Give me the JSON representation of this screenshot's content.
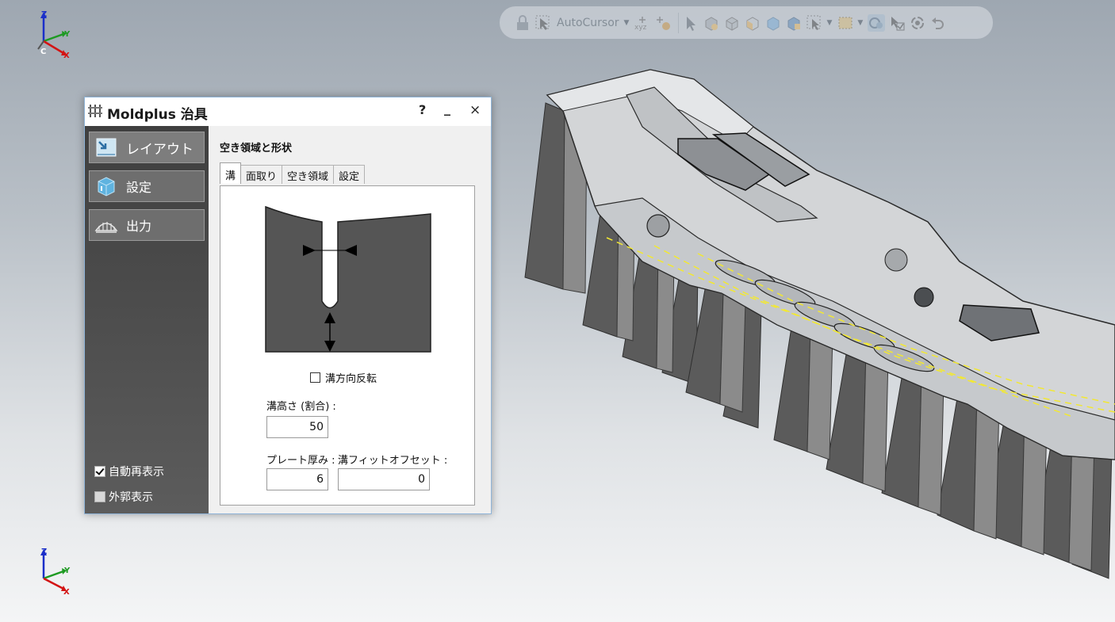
{
  "toolbar": {
    "autocursor_label": "AutoCursor"
  },
  "triad_top": {
    "z": "Z",
    "y": "Y",
    "x": "X",
    "c": "C"
  },
  "triad_bottom": {
    "z": "Z",
    "y": "Y",
    "x": "X"
  },
  "dialog": {
    "title": "Moldplus 治具",
    "help": "?",
    "minimize": "_",
    "close": "×",
    "nav": [
      {
        "label": "レイアウト",
        "icon": "layout-icon"
      },
      {
        "label": "設定",
        "icon": "settings-cube-icon"
      },
      {
        "label": "出力",
        "icon": "output-icon"
      }
    ],
    "auto_redisplay": {
      "label": "自動再表示",
      "checked": true
    },
    "outline_display": {
      "label": "外郭表示",
      "checked": false
    },
    "section_title": "空き領域と形状",
    "tabs": [
      "溝",
      "面取り",
      "空き領域",
      "設定"
    ],
    "active_tab": "溝",
    "flip_direction_label": "溝方向反転",
    "groove_height_label": "溝高さ (割合) :",
    "groove_height_value": "50",
    "plate_thickness_label": "プレート厚み :",
    "plate_thickness_value": "6",
    "groove_fit_offset_label": "溝フィットオフセット :",
    "groove_fit_offset_value": "0"
  },
  "colors": {
    "sidebar_dark": "#3f3f3f",
    "preview_fill": "#555555",
    "dialog_border": "#8fb4d8",
    "guide_line": "#f2e832"
  }
}
